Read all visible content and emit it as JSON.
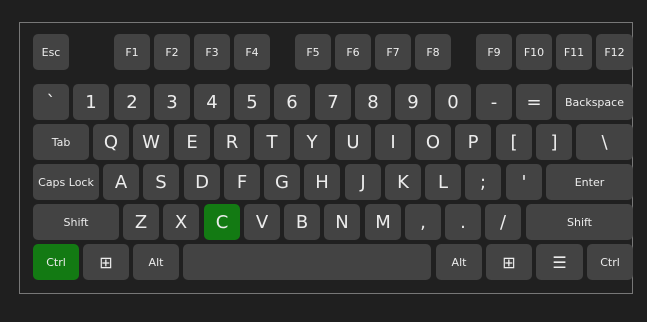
{
  "keyboard": {
    "function_row": [
      "Esc",
      "F1",
      "F2",
      "F3",
      "F4",
      "F5",
      "F6",
      "F7",
      "F8",
      "F9",
      "F10",
      "F11",
      "F12"
    ],
    "number_row": [
      "`",
      "1",
      "2",
      "3",
      "4",
      "5",
      "6",
      "7",
      "8",
      "9",
      "0",
      "-",
      "=",
      "Backspace"
    ],
    "top_row": [
      "Tab",
      "Q",
      "W",
      "E",
      "R",
      "T",
      "Y",
      "U",
      "I",
      "O",
      "P",
      "[",
      "]",
      "\\"
    ],
    "home_row": [
      "Caps Lock",
      "A",
      "S",
      "D",
      "F",
      "G",
      "H",
      "J",
      "K",
      "L",
      ";",
      "'",
      "Enter"
    ],
    "bottom_row": [
      "Shift",
      "Z",
      "X",
      "C",
      "V",
      "B",
      "N",
      "M",
      ",",
      ".",
      "/",
      "Shift"
    ],
    "modifier_row": [
      "Ctrl",
      "⊞",
      "Alt",
      "",
      "Alt",
      "⊞",
      "☰",
      "Ctrl"
    ],
    "pressed_keys": [
      "Ctrl",
      "C"
    ],
    "pressed_color": "#137a13",
    "key_color": "#434343"
  }
}
